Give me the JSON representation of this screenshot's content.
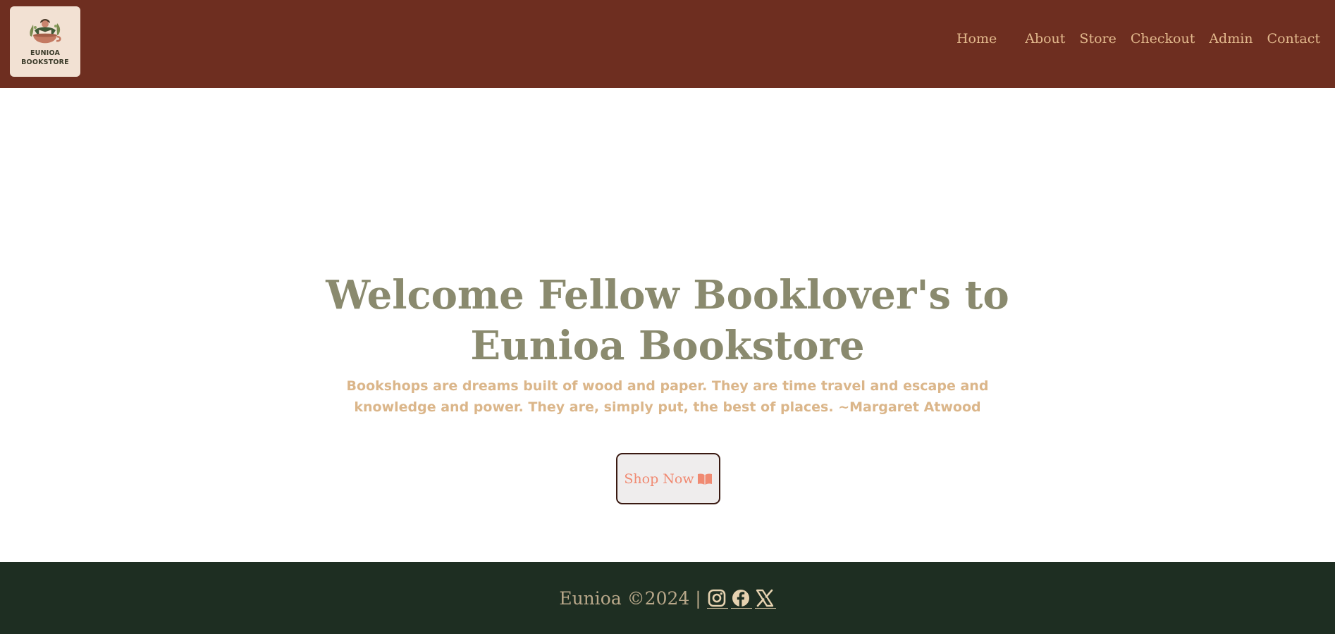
{
  "brand": {
    "logo_line1": "EUNIOA",
    "logo_line2": "BOOKSTORE"
  },
  "nav": {
    "items": [
      {
        "label": "Home"
      },
      {
        "label": "About"
      },
      {
        "label": "Store"
      },
      {
        "label": "Checkout"
      },
      {
        "label": "Admin"
      },
      {
        "label": "Contact"
      }
    ]
  },
  "hero": {
    "title_line1": "Welcome Fellow Booklover's to",
    "title_line2": "Eunioa Bookstore",
    "quote": "Bookshops are dreams built of wood and paper. They are time travel and escape and knowledge and power. They are, simply put, the best of places. ~Margaret Atwood",
    "cta_label": "Shop Now",
    "cta_icon": "open-book-icon"
  },
  "footer": {
    "copyright": "Eunioa ©2024 |",
    "social": [
      {
        "icon": "instagram-icon"
      },
      {
        "icon": "facebook-icon"
      },
      {
        "icon": "x-twitter-icon"
      }
    ]
  },
  "colors": {
    "header_bg": "#6e2e20",
    "nav_text": "#e2b88c",
    "title": "#8a8a6e",
    "quote": "#dbb68a",
    "cta_text": "#f08a72",
    "footer_bg": "#1e2e22",
    "footer_text": "#b9a88a"
  }
}
